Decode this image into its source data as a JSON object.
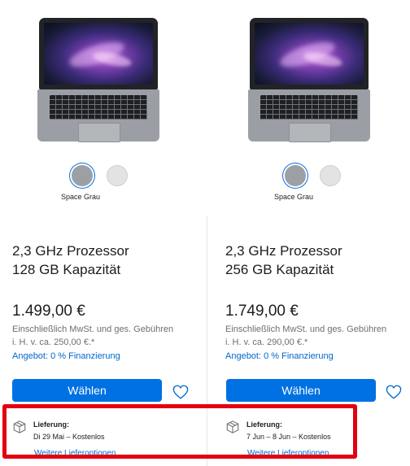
{
  "products": [
    {
      "color_label": "Space Grau",
      "spec_line1": "2,3 GHz Prozessor",
      "spec_line2": "128 GB Kapazität",
      "price": "1.499,00 €",
      "tax_note": "Einschließlich MwSt. und ges. Gebühren",
      "rebate_note": "i. H. v. ca. 250,00 €.*",
      "financing_link": "Angebot: 0 % Finanzierung",
      "select_label": "Wählen",
      "delivery_title": "Lieferung:",
      "delivery_date": "Di 29 Mai – Kostenlos",
      "more_options": "Weitere Lieferoptionen"
    },
    {
      "color_label": "Space Grau",
      "spec_line1": "2,3 GHz Prozessor",
      "spec_line2": "256 GB Kapazität",
      "price": "1.749,00 €",
      "tax_note": "Einschließlich MwSt. und ges. Gebühren",
      "rebate_note": "i. H. v. ca. 290,00 €.*",
      "financing_link": "Angebot: 0 % Finanzierung",
      "select_label": "Wählen",
      "delivery_title": "Lieferung:",
      "delivery_date": "7 Jun – 8 Jun – Kostenlos",
      "more_options": "Weitere Lieferoptionen"
    }
  ],
  "swatches": [
    "Space Grau",
    "Silber"
  ],
  "colors": {
    "accent": "#0071e3",
    "link": "#0066cc",
    "highlight": "#e3000f",
    "space_gray": "#9c9fa4",
    "silver": "#e2e3e4"
  },
  "icons": [
    "heart-icon",
    "package-box-icon"
  ]
}
